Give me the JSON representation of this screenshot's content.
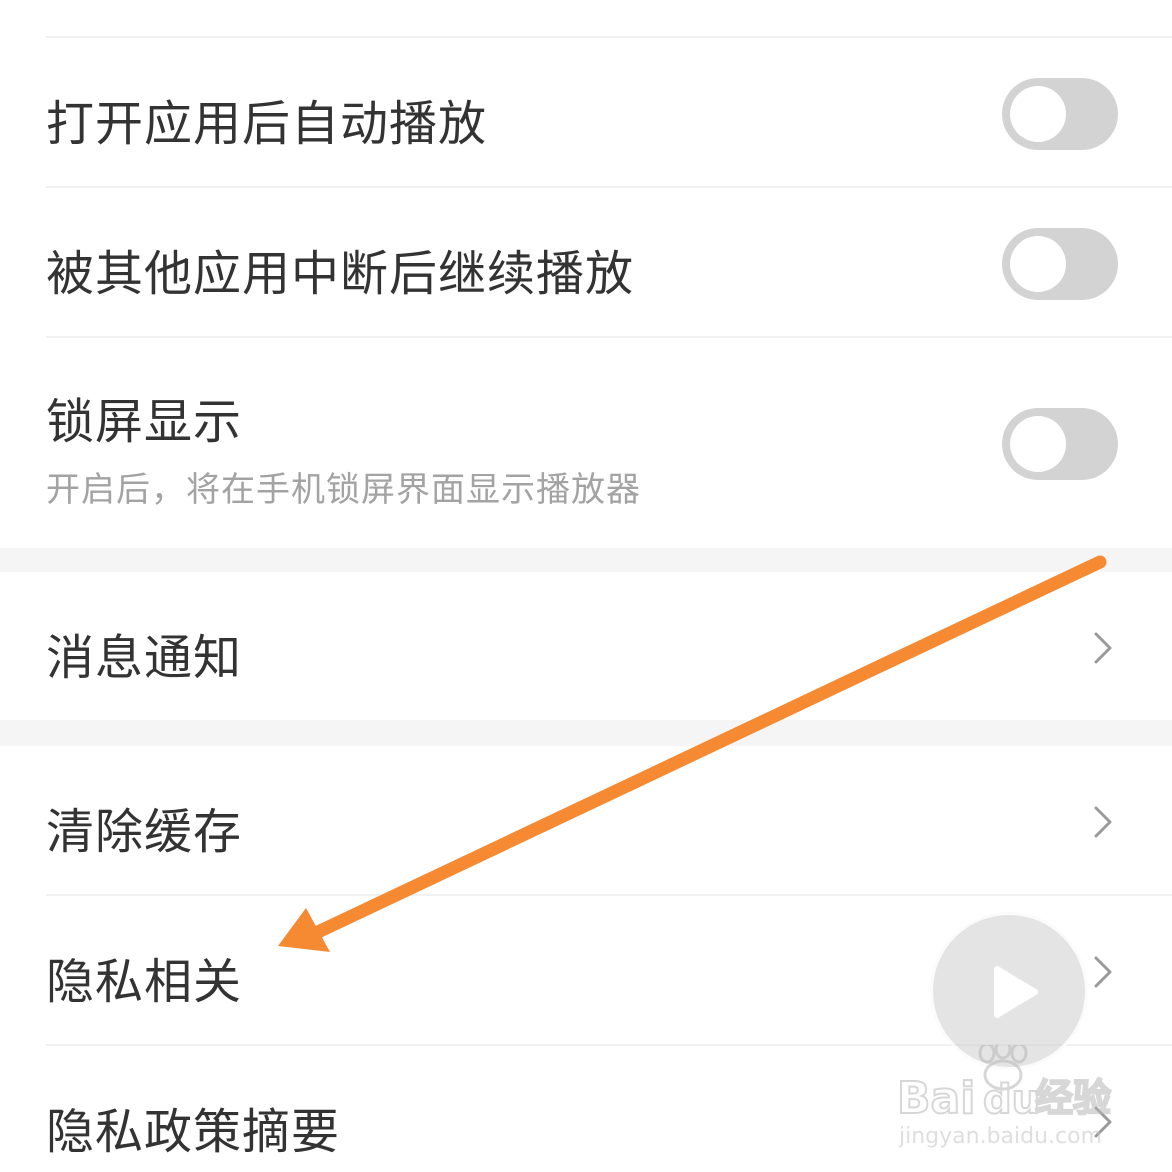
{
  "settings": {
    "auto_play": {
      "label": "打开应用后自动播放",
      "enabled": false
    },
    "resume_play": {
      "label": "被其他应用中断后继续播放",
      "enabled": false
    },
    "lock_screen": {
      "label": "锁屏显示",
      "description": "开启后，将在手机锁屏界面显示播放器",
      "enabled": false
    },
    "notifications": {
      "label": "消息通知"
    },
    "clear_cache": {
      "label": "清除缓存"
    },
    "privacy": {
      "label": "隐私相关"
    },
    "privacy_policy": {
      "label": "隐私政策摘要"
    }
  },
  "annotation": {
    "color": "#f58a33",
    "points_to": "隐私相关"
  },
  "watermark": {
    "brand_logo": "Bai du 经验",
    "url": "jingyan.baidu.com"
  },
  "colors": {
    "toggle_off": "#d3d3d3",
    "text": "#333333",
    "subtext": "#a3a3a3",
    "section_gap": "#f5f5f5"
  }
}
